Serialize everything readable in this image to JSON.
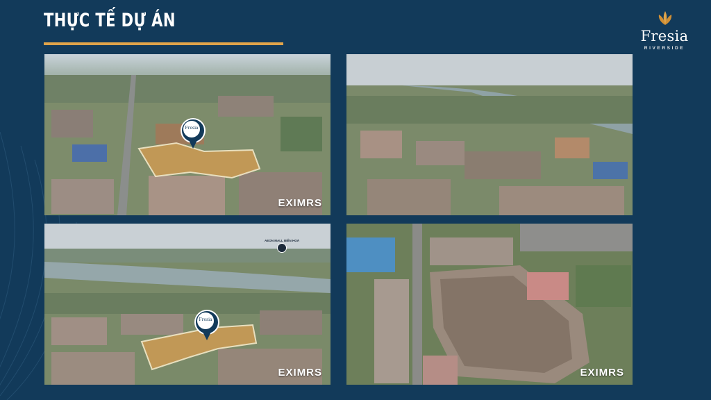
{
  "slide": {
    "title": "THỰC TẾ DỰ ÁN",
    "accent_color": "#e0a44a",
    "background_color": "#123a5a"
  },
  "logo": {
    "brand": "Fresia",
    "sub": "RIVERSIDE",
    "icon": "lotus-flower-icon"
  },
  "photos": [
    {
      "watermark": "EXIMRS",
      "marker_text": "Fresia"
    },
    {
      "watermark": ""
    },
    {
      "watermark": "EXIMRS",
      "marker_text": "Fresia",
      "poi_label": "AEON MALL BIÊN HOÀ"
    },
    {
      "watermark": "EXIMRS"
    }
  ]
}
